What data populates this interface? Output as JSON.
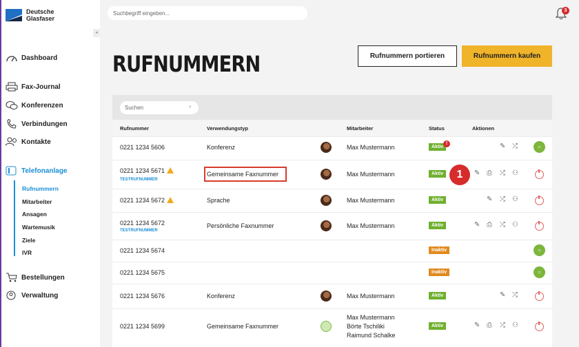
{
  "brand": {
    "line1": "Deutsche",
    "line2": "Glasfaser"
  },
  "topbar": {
    "search_placeholder": "Suchbegriff eingeben...",
    "notifications_count": "3"
  },
  "nav": {
    "dashboard": "Dashboard",
    "fax_journal": "Fax-Journal",
    "konferenzen": "Konferenzen",
    "verbindungen": "Verbindungen",
    "kontakte": "Kontakte",
    "telefonanlage": "Telefonanlage",
    "sub": [
      "Rufnummern",
      "Mitarbeiter",
      "Ansagen",
      "Wartemusik",
      "Ziele",
      "IVR"
    ],
    "bestellungen": "Bestellungen",
    "verwaltung": "Verwaltung"
  },
  "page": {
    "title": "RUFNUMMERN",
    "btn_portieren": "Rufnummern portieren",
    "btn_kaufen": "Rufnummern kaufen"
  },
  "table": {
    "search_placeholder": "Suchen",
    "headers": {
      "rufnummer": "Rufnummer",
      "verwendungstyp": "Verwendungstyp",
      "mitarbeiter": "Mitarbeiter",
      "status": "Status",
      "aktionen": "Aktionen"
    },
    "rows": [
      {
        "number": "0221 1234 5606",
        "sub": "",
        "type": "Konferenz",
        "employee": "Max Mustermann",
        "status": "Aktiv"
      },
      {
        "number": "0221 1234 5671",
        "sub": "TESTRUFNUMMER",
        "type": "Gemeinsame Faxnummer",
        "employee": "Max Mustermann",
        "status": "Aktiv"
      },
      {
        "number": "0221 1234 5672",
        "sub": "",
        "type": "Sprache",
        "employee": "Max Mustermann",
        "status": "Aktiv"
      },
      {
        "number": "0221 1234 5672",
        "sub": "TESTRUFNUMMER",
        "type": "Persönliche Faxnummer",
        "employee": "Max Mustermann",
        "status": "Aktiv"
      },
      {
        "number": "0221 1234 5674",
        "sub": "",
        "type": "",
        "employee": "",
        "status": "Inaktiv"
      },
      {
        "number": "0221 1234 5675",
        "sub": "",
        "type": "",
        "employee": "",
        "status": "Inaktiv"
      },
      {
        "number": "0221 1234 5676",
        "sub": "",
        "type": "Konferenz",
        "employee": "Max Mustermann",
        "status": "Aktiv"
      },
      {
        "number": "0221 1234 5699",
        "sub": "",
        "type": "Gemeinsame Faxnummer",
        "employee_lines": [
          "Max Mustermann",
          "Börte Tschiliki",
          "Raimund Schalke"
        ],
        "status": "Aktiv"
      }
    ]
  },
  "annotation": {
    "step": "1"
  },
  "colors": {
    "accent": "#1b8ed6",
    "primary_button": "#f0b42a",
    "active_badge": "#6fb02e",
    "inactive_badge": "#e08a1e",
    "alert": "#d62c2c"
  }
}
